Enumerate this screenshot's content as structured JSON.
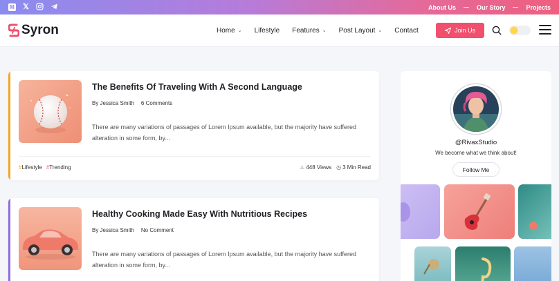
{
  "topbar": {
    "social_icons": [
      "medium-icon",
      "x-icon",
      "instagram-icon",
      "telegram-icon"
    ],
    "links": [
      "About Us",
      "Our Story",
      "Projects"
    ]
  },
  "header": {
    "logo_text": "Syron",
    "nav": [
      {
        "label": "Home",
        "has_dropdown": true
      },
      {
        "label": "Lifestyle",
        "has_dropdown": false
      },
      {
        "label": "Features",
        "has_dropdown": true
      },
      {
        "label": "Post Layout",
        "has_dropdown": true
      },
      {
        "label": "Contact",
        "has_dropdown": false
      }
    ],
    "join_label": "Join Us",
    "accent_color": "#f0506e"
  },
  "posts": [
    {
      "title": "The Benefits Of Traveling With A Second Language",
      "author": "By Jessica Smith",
      "comments": "6 Comments",
      "excerpt": "There are many variations of passages of Lorem Ipsum available, but the majority have suffered alteration in some form, by...",
      "tags": [
        "Lifestyle",
        "Trending"
      ],
      "views": "448 Views",
      "read_time": "3 Min Read",
      "accent_color": "#f5a623"
    },
    {
      "title": "Healthy Cooking Made Easy With Nutritious Recipes",
      "author": "By Jessica Smith",
      "comments": "No Comment",
      "excerpt": "There are many variations of passages of Lorem Ipsum available, but the majority have suffered alteration in some form, by...",
      "accent_color": "#8f6ce0"
    }
  ],
  "sidebar": {
    "handle": "@RivaxStudio",
    "motto": "We become what we think about!",
    "follow_label": "Follow Me"
  }
}
